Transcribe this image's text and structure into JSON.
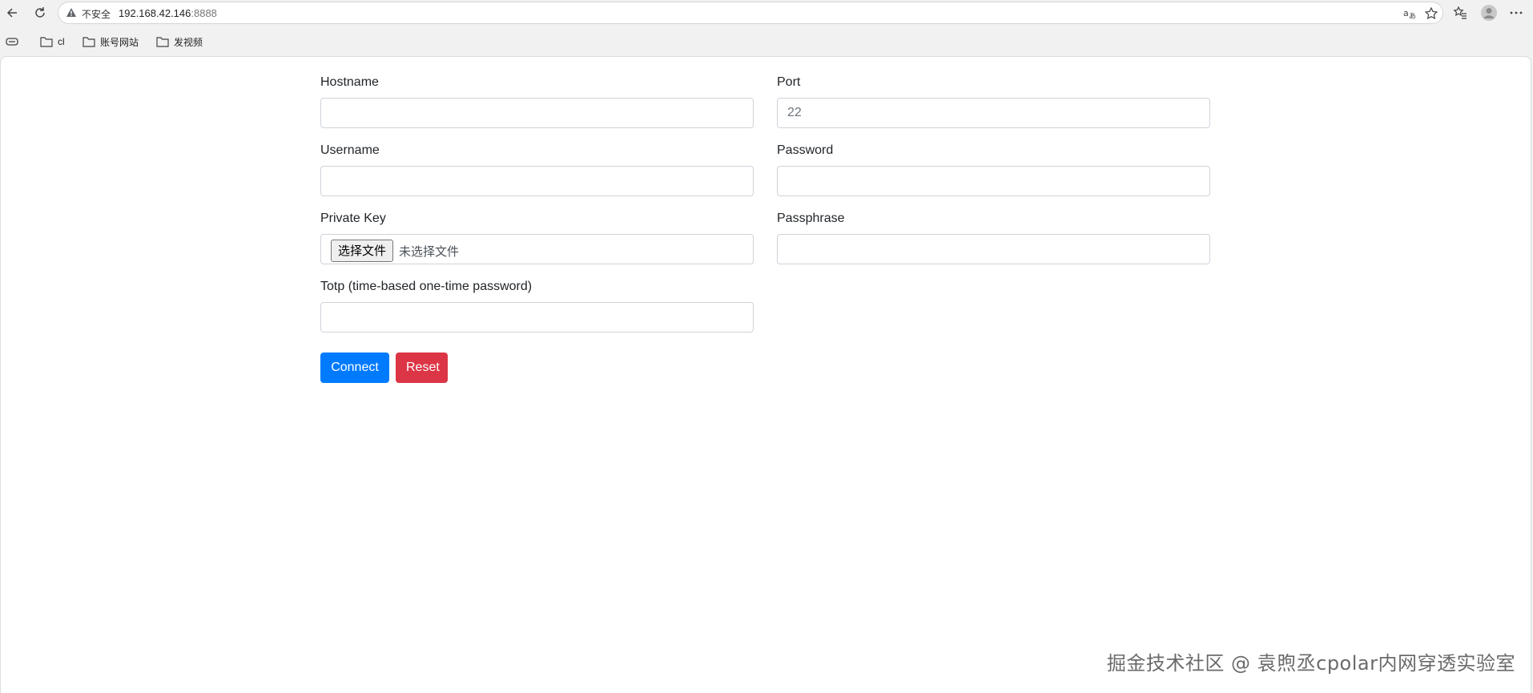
{
  "browser": {
    "security_label": "不安全",
    "url_host": "192.168.42.146",
    "url_port": ":8888",
    "bookmarks": [
      {
        "label": "cl",
        "icon": "folder-icon"
      },
      {
        "label": "账号网站",
        "icon": "folder-icon"
      },
      {
        "label": "发视频",
        "icon": "folder-icon"
      }
    ]
  },
  "form": {
    "hostname_label": "Hostname",
    "hostname_value": "",
    "port_label": "Port",
    "port_placeholder": "22",
    "username_label": "Username",
    "username_value": "",
    "password_label": "Password",
    "password_value": "",
    "private_key_label": "Private Key",
    "file_button_label": "选择文件",
    "file_status": "未选择文件",
    "passphrase_label": "Passphrase",
    "passphrase_value": "",
    "totp_label": "Totp (time-based one-time password)",
    "totp_value": "",
    "connect_label": "Connect",
    "reset_label": "Reset"
  },
  "watermark": "掘金技术社区 @ 袁煦丞cpolar内网穿透实验室",
  "colors": {
    "primary": "#007bff",
    "danger": "#dc3545",
    "input_border": "#ced4da"
  }
}
